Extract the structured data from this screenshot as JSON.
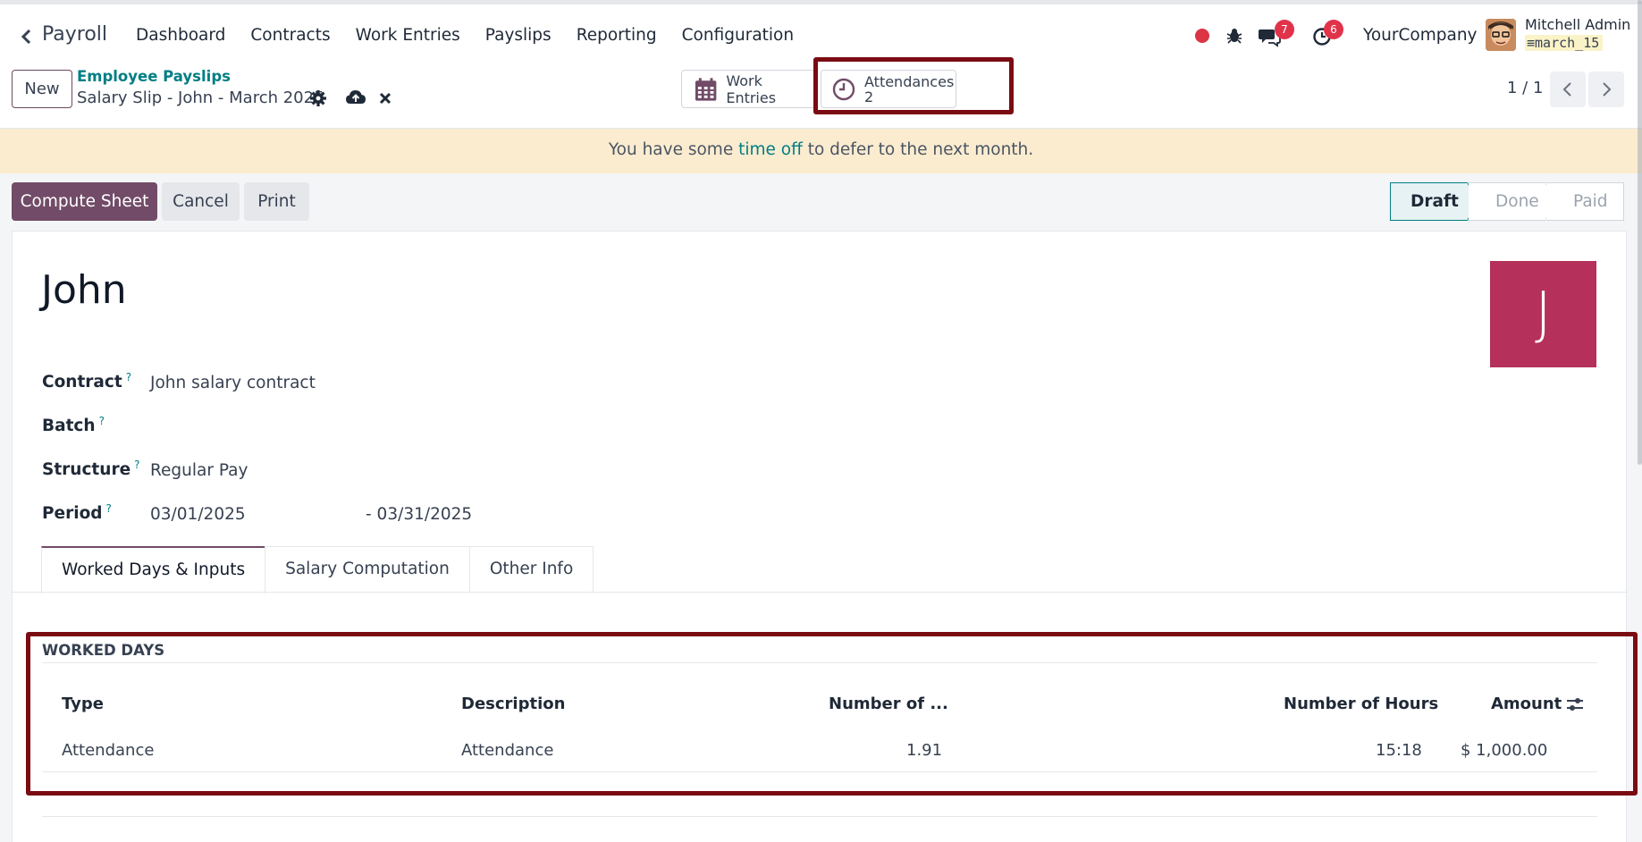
{
  "navbar": {
    "app_name": "Payroll",
    "menu": [
      "Dashboard",
      "Contracts",
      "Work Entries",
      "Payslips",
      "Reporting",
      "Configuration"
    ],
    "chat_count": "7",
    "activity_count": "6",
    "company": "YourCompany",
    "user_name": "Mitchell Admin",
    "database": "march_15"
  },
  "control_panel": {
    "new_label": "New",
    "breadcrumb_parent": "Employee Payslips",
    "breadcrumb_current": "Salary Slip - John - March 2025",
    "smart_buttons": {
      "work_entries_label": "Work Entries",
      "attendances_label": "Attendances",
      "attendances_count": "2"
    },
    "pager": "1 / 1"
  },
  "alert": {
    "prefix": "You have some ",
    "link": "time off",
    "suffix": " to defer to the next month."
  },
  "status_bar": {
    "compute_label": "Compute Sheet",
    "cancel_label": "Cancel",
    "print_label": "Print",
    "stages": [
      "Draft",
      "Done",
      "Paid"
    ],
    "active_stage": "Draft"
  },
  "form": {
    "employee_name": "John",
    "avatar_letter": "J",
    "fields": {
      "contract_label": "Contract",
      "contract_value": "John salary contract",
      "batch_label": "Batch",
      "batch_value": "",
      "structure_label": "Structure",
      "structure_value": "Regular Pay",
      "period_label": "Period",
      "period_from": "03/01/2025",
      "period_to": "- 03/31/2025"
    },
    "help_mark": "?",
    "tabs": [
      "Worked Days & Inputs",
      "Salary Computation",
      "Other Info"
    ],
    "active_tab": "Worked Days & Inputs"
  },
  "worked_days": {
    "title": "WORKED DAYS",
    "columns": {
      "type": "Type",
      "description": "Description",
      "number_of_days": "Number of ...",
      "number_of_hours": "Number of Hours",
      "amount": "Amount"
    },
    "rows": [
      {
        "type": "Attendance",
        "description": "Attendance",
        "number_of_days": "1.91",
        "number_of_hours": "15:18",
        "amount": "$ 1,000.00"
      }
    ]
  },
  "colors": {
    "brand": "#714b67",
    "link": "#017e84",
    "highlight": "#7a0b12",
    "alert_bg": "#fbecd0",
    "avatar_bg": "#b5305a"
  },
  "icons": [
    "chevron-left-icon",
    "record-icon",
    "bug-icon",
    "chat-icon",
    "clock-icon",
    "settings-gear-icon",
    "cloud-upload-icon",
    "close-icon",
    "calendar-icon",
    "optional-columns-icon"
  ]
}
